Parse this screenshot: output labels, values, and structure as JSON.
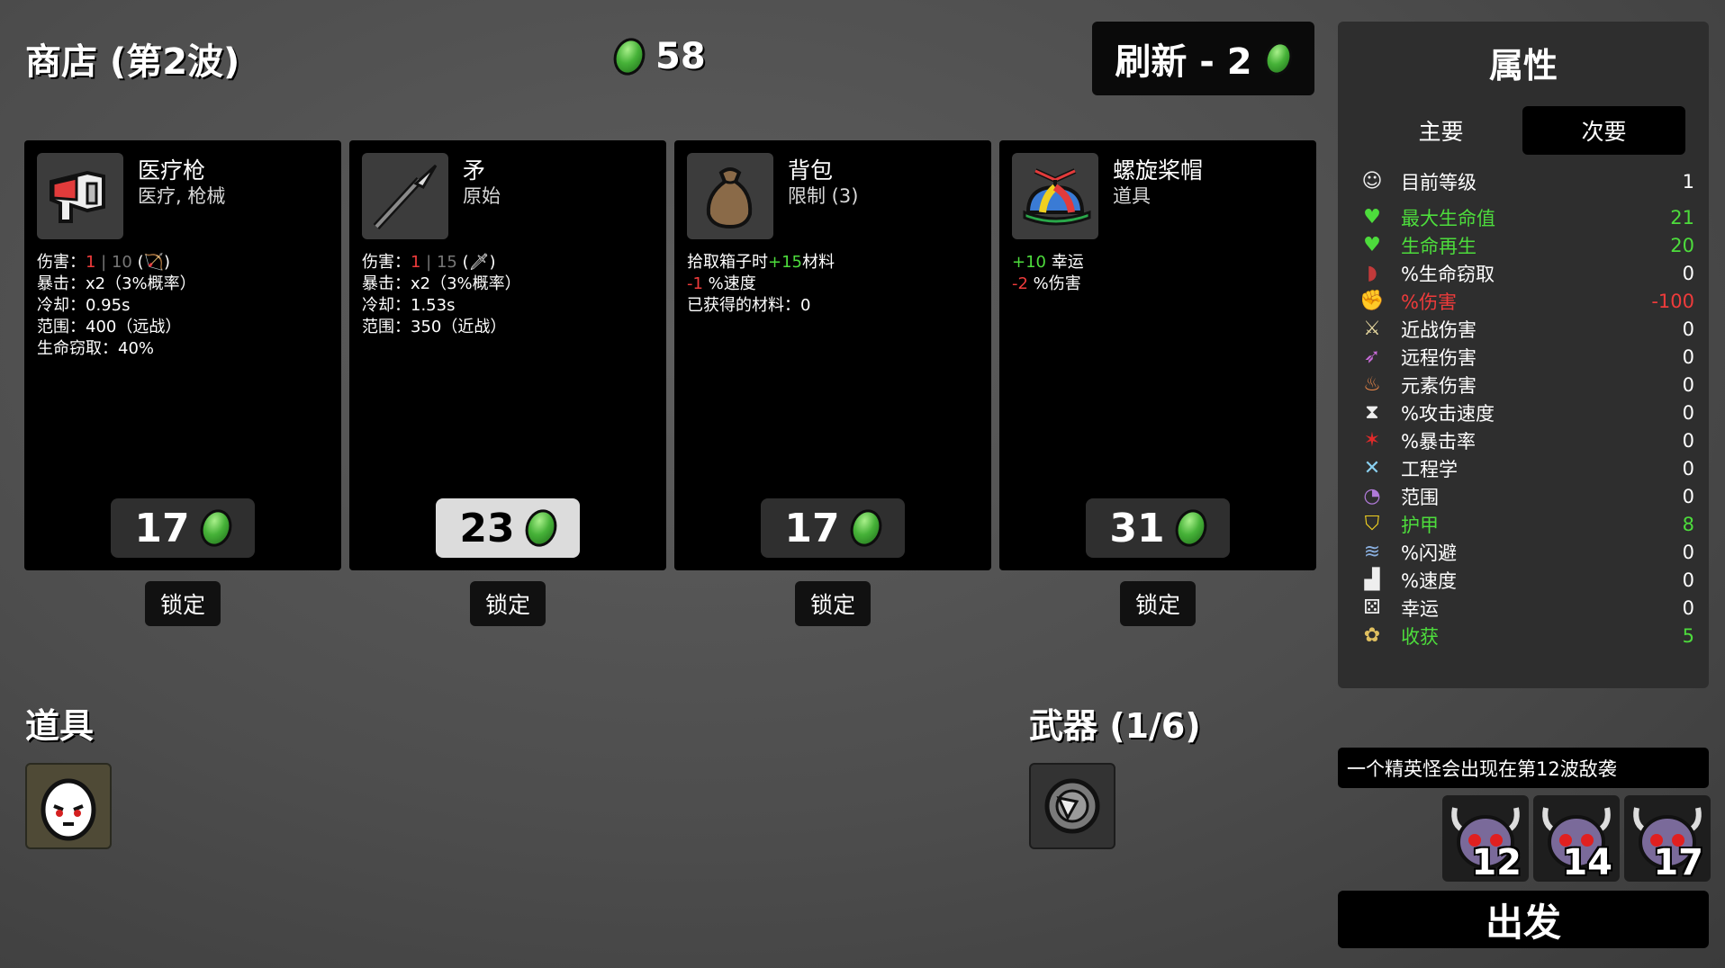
{
  "shop": {
    "title": "商店 (第2波)",
    "money": "58",
    "refresh_label": "刷新 - 2",
    "lock_label": "锁定"
  },
  "cards": [
    {
      "name": "医疗枪",
      "sub": "医疗, 枪械",
      "price": "17",
      "lines": [
        {
          "pre": "伤害：",
          "a": "1",
          "b": "10",
          "post": "(🏹)"
        },
        "暴击：x2（3%概率）",
        "冷却：0.95s",
        "范围：400（远战）",
        "生命窃取：40%"
      ]
    },
    {
      "name": "矛",
      "sub": "原始",
      "price": "23",
      "lines": [
        {
          "pre": "伤害：",
          "a": "1",
          "b": "15",
          "post": "(🗡)"
        },
        "暴击：x2（3%概率）",
        "冷却：1.53s",
        "范围：350（近战）"
      ]
    },
    {
      "name": "背包",
      "sub": "限制 (3)",
      "price": "17",
      "lines": [
        {
          "pre": "拾取箱子时",
          "g": "+15",
          "post": "材料"
        },
        {
          "r": "-1",
          "post": " %速度"
        },
        "已获得的材料：0"
      ]
    },
    {
      "name": "螺旋桨帽",
      "sub": "道具",
      "price": "31",
      "lines": [
        {
          "g": "+10",
          "post": " 幸运"
        },
        {
          "r": "-2",
          "post": " %伤害"
        }
      ]
    }
  ],
  "items_title": "道具",
  "weapons_title": "武器 (1/6)",
  "stats": {
    "title": "属性",
    "tab_primary": "主要",
    "tab_secondary": "次要",
    "rows": [
      {
        "icon": "level-icon",
        "label": "目前等级",
        "value": "1",
        "color": "#ffffff"
      },
      {
        "icon": "heart-icon",
        "label": "最大生命值",
        "value": "21",
        "color": "#4ddc3c"
      },
      {
        "icon": "heart-plus-icon",
        "label": "生命再生",
        "value": "20",
        "color": "#4ddc3c"
      },
      {
        "icon": "fang-icon",
        "label": "%生命窃取",
        "value": "0",
        "color": "#ffffff"
      },
      {
        "icon": "muscle-icon",
        "label": "%伤害",
        "value": "-100",
        "color": "#ee3b3b"
      },
      {
        "icon": "sword-icon",
        "label": "近战伤害",
        "value": "0",
        "color": "#ffffff"
      },
      {
        "icon": "bow-icon",
        "label": "远程伤害",
        "value": "0",
        "color": "#ffffff"
      },
      {
        "icon": "flame-icon",
        "label": "元素伤害",
        "value": "0",
        "color": "#ffffff"
      },
      {
        "icon": "hourglass-icon",
        "label": "%攻击速度",
        "value": "0",
        "color": "#ffffff"
      },
      {
        "icon": "crit-star-icon",
        "label": "%暴击率",
        "value": "0",
        "color": "#ffffff"
      },
      {
        "icon": "wrench-icon",
        "label": "工程学",
        "value": "0",
        "color": "#ffffff"
      },
      {
        "icon": "range-icon",
        "label": "范围",
        "value": "0",
        "color": "#ffffff"
      },
      {
        "icon": "shield-icon",
        "label": "护甲",
        "value": "8",
        "color": "#4ddc3c"
      },
      {
        "icon": "dodge-icon",
        "label": "%闪避",
        "value": "0",
        "color": "#ffffff"
      },
      {
        "icon": "boot-icon",
        "label": "%速度",
        "value": "0",
        "color": "#ffffff"
      },
      {
        "icon": "dice-icon",
        "label": "幸运",
        "value": "0",
        "color": "#ffffff"
      },
      {
        "icon": "harvest-icon",
        "label": "收获",
        "value": "5",
        "color": "#4ddc3c"
      }
    ]
  },
  "notice": "一个精英怪会出现在第12波敌袭",
  "waves": [
    "12",
    "14",
    "17"
  ],
  "go_label": "出发"
}
